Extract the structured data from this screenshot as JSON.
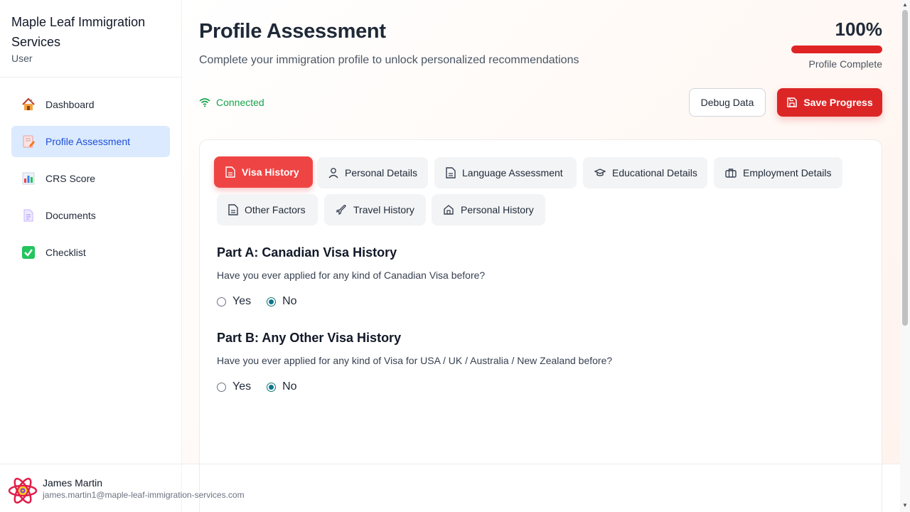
{
  "brand": {
    "title": "Maple Leaf Immigration Services",
    "role": "User"
  },
  "nav": {
    "items": [
      {
        "label": "Dashboard",
        "icon": "house-icon"
      },
      {
        "label": "Profile Assessment",
        "icon": "memo-icon",
        "active": true
      },
      {
        "label": "CRS Score",
        "icon": "bar-chart-icon"
      },
      {
        "label": "Documents",
        "icon": "document-icon"
      },
      {
        "label": "Checklist",
        "icon": "check-box-icon"
      }
    ]
  },
  "user": {
    "name": "James Martin",
    "email": "james.martin1@maple-leaf-immigration-services.com"
  },
  "header": {
    "title": "Profile Assessment",
    "subtitle": "Complete your immigration profile to unlock personalized recommendations",
    "progress_percent_text": "100%",
    "progress_value": 1.0,
    "progress_label": "Profile Complete"
  },
  "status": {
    "connection": "Connected"
  },
  "actions": {
    "debug_label": "Debug Data",
    "save_label": "Save Progress"
  },
  "tabs": [
    {
      "label": "Visa History",
      "icon": "document-icon",
      "active": true
    },
    {
      "label": "Personal Details",
      "icon": "user-icon"
    },
    {
      "label": "Language Assessment",
      "icon": "document-icon"
    },
    {
      "label": "Educational Details",
      "icon": "graduation-cap-icon"
    },
    {
      "label": "Employment Details",
      "icon": "briefcase-icon"
    },
    {
      "label": "Other Factors",
      "icon": "document-icon"
    },
    {
      "label": "Travel History",
      "icon": "plane-icon"
    },
    {
      "label": "Personal History",
      "icon": "home-icon"
    }
  ],
  "form": {
    "part_a": {
      "title": "Part A: Canadian Visa History",
      "question": "Have you ever applied for any kind of Canadian Visa before?",
      "options": [
        "Yes",
        "No"
      ],
      "selected": "No"
    },
    "part_b": {
      "title": "Part B: Any Other Visa History",
      "question": "Have you ever applied for any kind of Visa for USA / UK / Australia / New Zealand before?",
      "options": [
        "Yes",
        "No"
      ],
      "selected": "No"
    }
  },
  "colors": {
    "accent": "#dc2626",
    "active_nav_bg": "#dbeafe",
    "active_nav_text": "#1d4ed8",
    "connected": "#16a34a",
    "radio_checked": "#0e7490"
  }
}
